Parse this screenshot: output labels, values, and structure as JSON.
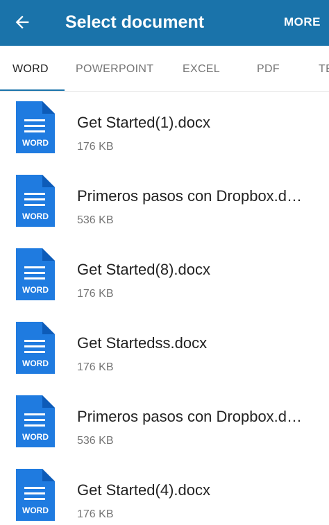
{
  "appbar": {
    "back_icon": "arrow-back-icon",
    "title": "Select document",
    "more_label": "MORE",
    "color": "#1a73aa"
  },
  "tabs": [
    {
      "label": "WORD",
      "active": true
    },
    {
      "label": "POWERPOINT",
      "active": false
    },
    {
      "label": "EXCEL",
      "active": false
    },
    {
      "label": "PDF",
      "active": false
    },
    {
      "label": "TE",
      "active": false
    }
  ],
  "files": [
    {
      "name": "Get Started(1).docx",
      "size": "176 KB",
      "icon_label": "WORD"
    },
    {
      "name": "Primeros pasos con Dropbox.d…",
      "size": "536 KB",
      "icon_label": "WORD"
    },
    {
      "name": "Get Started(8).docx",
      "size": "176 KB",
      "icon_label": "WORD"
    },
    {
      "name": "Get Startedss.docx",
      "size": "176 KB",
      "icon_label": "WORD"
    },
    {
      "name": "Primeros pasos con Dropbox.d…",
      "size": "536 KB",
      "icon_label": "WORD"
    },
    {
      "name": "Get Started(4).docx",
      "size": "176 KB",
      "icon_label": "WORD"
    }
  ],
  "colors": {
    "word_icon": "#1f7be0",
    "word_icon_fold": "#0d5bb8"
  }
}
